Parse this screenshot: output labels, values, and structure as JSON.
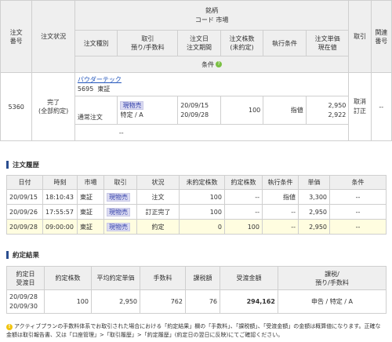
{
  "order_header": {
    "order_no": "注文\n番号",
    "status": "注文状況",
    "brand": "銘柄",
    "code_market": "コード 市場",
    "order_type": "注文種別",
    "trade": "取引\n預り/手数料",
    "order_date": "注文日\n注文期間",
    "qty": "注文株数\n(未約定)",
    "exec_cond": "執行条件",
    "price": "注文単価\n現在値",
    "action": "取引",
    "related": "関連\n番号",
    "conditions": "条件"
  },
  "order_row": {
    "order_no": "5360",
    "status": "完了\n(全部約定)",
    "name": "パウダーテック",
    "code": "5695",
    "market": "東証",
    "order_type": "通常注文",
    "trade_tag": "現物売",
    "trade_sub": "特定 / A",
    "date1": "20/09/15",
    "date2": "20/09/28",
    "qty": "100",
    "exec": "指値",
    "price": "2,950",
    "current": "2,922",
    "action1": "取消",
    "action2": "訂正",
    "related": "--",
    "condition_val": "--"
  },
  "history": {
    "title": "注文履歴",
    "headers": [
      "日付",
      "時刻",
      "市場",
      "取引",
      "状況",
      "未約定株数",
      "約定株数",
      "執行条件",
      "単価",
      "条件"
    ],
    "rows": [
      {
        "date": "20/09/15",
        "time": "18:10:43",
        "market": "東証",
        "trade": "現物売",
        "status": "注文",
        "unfilled": "100",
        "filled": "--",
        "exec": "指値",
        "price": "3,300",
        "cond": "--"
      },
      {
        "date": "20/09/26",
        "time": "17:55:57",
        "market": "東証",
        "trade": "現物売",
        "status": "訂正完了",
        "unfilled": "100",
        "filled": "--",
        "exec": "--",
        "price": "2,950",
        "cond": "--"
      },
      {
        "date": "20/09/28",
        "time": "09:00:00",
        "market": "東証",
        "trade": "現物売",
        "status": "約定",
        "unfilled": "0",
        "filled": "100",
        "exec": "--",
        "price": "2,950",
        "cond": "--"
      }
    ]
  },
  "result": {
    "title": "約定結果",
    "headers": [
      "約定日\n受渡日",
      "約定株数",
      "平均約定単価",
      "手数料",
      "課税額",
      "受渡金額",
      "課税/\n預り/手数料"
    ],
    "row": {
      "date1": "20/09/28",
      "date2": "20/09/30",
      "qty": "100",
      "avg": "2,950",
      "fee": "762",
      "tax": "76",
      "amount": "294,162",
      "kind": "申告 / 特定 / A"
    }
  },
  "note": "アクティブプランの手数料体系でお取引された場合における「約定結果」欄の「手数料」、「課税額」、「受渡金額」の金額は概算値になります。正確な金額は取引報告書、又は「口座管理」>「取引履歴」>「約定履歴」(約定日の翌日に反映)にてご確認ください。"
}
